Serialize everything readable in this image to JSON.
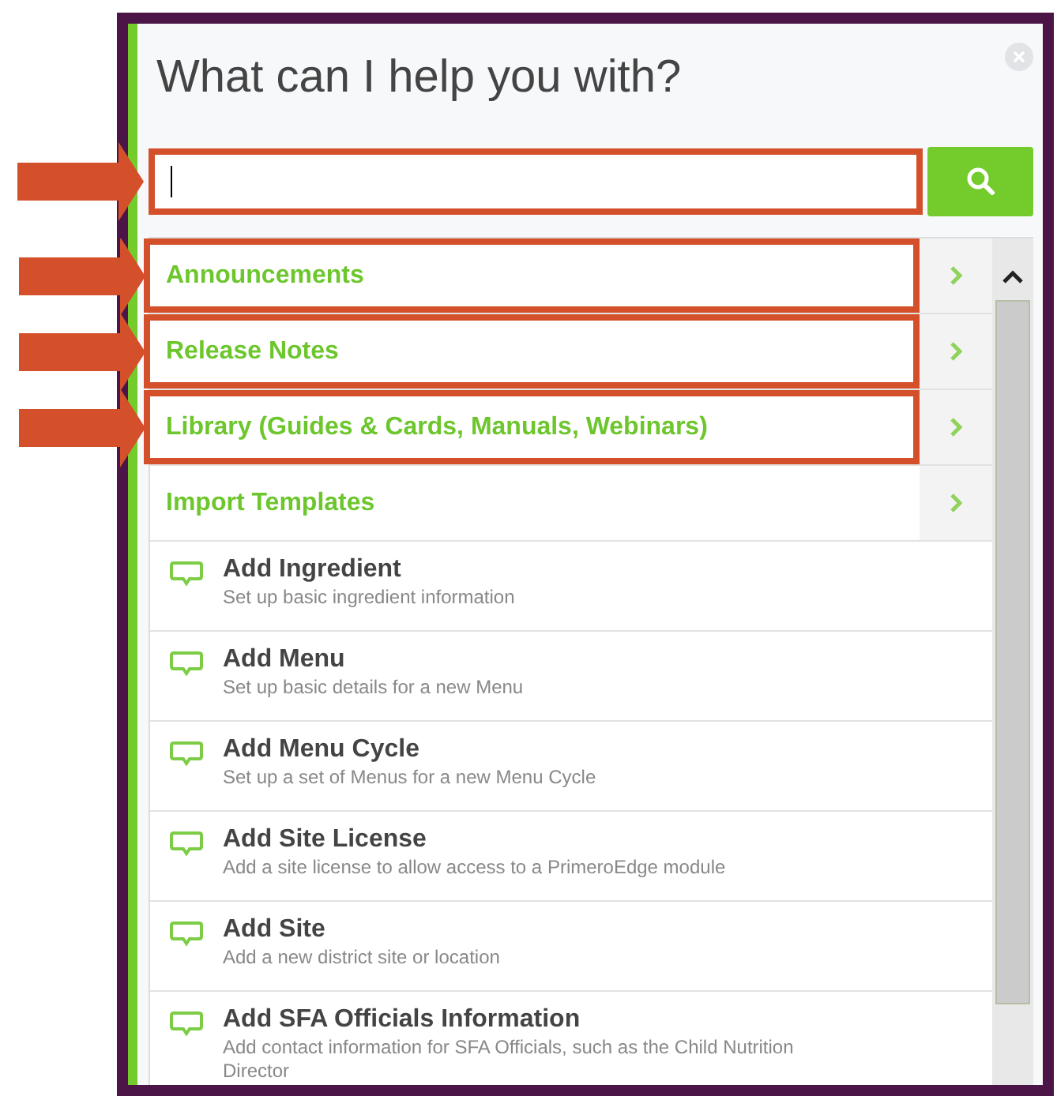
{
  "title": "What can I help you with?",
  "search": {
    "focused": true,
    "highlighted": true
  },
  "links": [
    {
      "label": "Announcements",
      "highlighted": true
    },
    {
      "label": "Release Notes",
      "highlighted": true
    },
    {
      "label": "Library (Guides & Cards, Manuals, Webinars)",
      "highlighted": true
    },
    {
      "label": "Import Templates",
      "highlighted": false
    }
  ],
  "actions": [
    {
      "title": "Add Ingredient",
      "description": "Set up basic ingredient information"
    },
    {
      "title": "Add Menu",
      "description": "Set up basic details for a new Menu"
    },
    {
      "title": "Add Menu Cycle",
      "description": "Set up a set of Menus for a new Menu Cycle"
    },
    {
      "title": "Add Site License",
      "description": "Add a site license to allow access to a PrimeroEdge module"
    },
    {
      "title": "Add Site",
      "description": "Add a new district site or location"
    },
    {
      "title": "Add SFA Officials Information",
      "description": "Add contact information for SFA Officials, such as the Child Nutrition Director"
    }
  ]
}
